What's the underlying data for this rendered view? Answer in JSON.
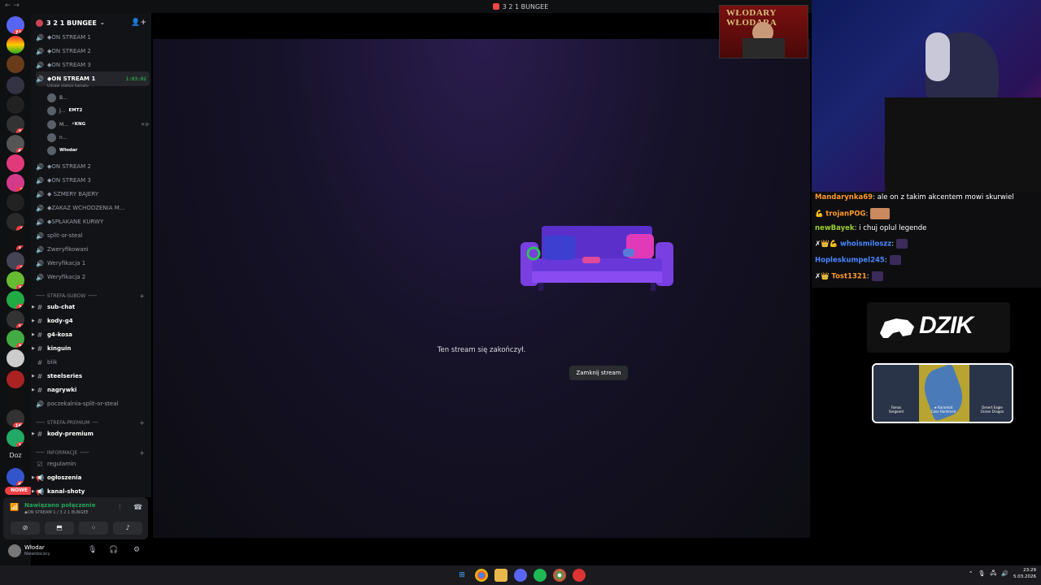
{
  "window": {
    "title": "3 2 1 BUNGEE"
  },
  "server": {
    "name": "3 2 1 BUNGEE"
  },
  "rail_badges": [
    "713",
    "26",
    "61",
    "3",
    "1",
    "16",
    "2",
    "23",
    "20",
    "17",
    "35",
    "162",
    "16",
    "61"
  ],
  "rail_text": {
    "doz": "Doz",
    "nowe": "NOWE"
  },
  "channels": {
    "v1": "◆ON STREAM 1",
    "v2": "◆ON STREAM 2",
    "v3": "◆ON STREAM 3",
    "active": "◆ON STREAM 1",
    "active_timer": "1:03:02",
    "active_status": "Ustaw status kanału",
    "members": [
      {
        "name": "B...",
        "tag": ""
      },
      {
        "name": "J...",
        "tag": "EMT2"
      },
      {
        "name": "M...",
        "tag": "⚡KNG"
      },
      {
        "name": "n...",
        "tag": ""
      },
      {
        "name": "Włodar",
        "tag": ""
      }
    ],
    "v4": "◆ON STREAM 2",
    "v5": "◆ON STREAM 3",
    "v6": "◆ SZMERY BAJERY",
    "v7": "◆ZAKAZ WCHODZENIA M...",
    "v8": "◆SPŁAKANE KURWY",
    "v9": "split-or-steal",
    "t1": "Zweryfikowani",
    "t2": "Weryfikacja 1",
    "t3": "Weryfikacja 2"
  },
  "cat_subow": "STREFA-SUBOW",
  "sub_channels": [
    "sub-chat",
    "kody-g4",
    "g4-kosa",
    "kinguin",
    "blik",
    "steelseries",
    "nagrywki",
    "poczekalnia-split-or-steal"
  ],
  "cat_premium": "STREFA-PREMIUM",
  "premium_channels": [
    "kody-premium"
  ],
  "cat_info": "INFORMACJE",
  "info_channels": [
    "regulamin",
    "ogłoszenia",
    "kanal-shoty"
  ],
  "voice_panel": {
    "status": "Nawiązano połączenie",
    "channel": "◆ON STREAM 1 / 3 2 1 BUNGEE"
  },
  "user": {
    "name": "Włodar",
    "status": "Niewidoczny"
  },
  "stream": {
    "ended": "Ten stream się zakończył.",
    "close": "Zamknij stream"
  },
  "overlay": {
    "wlodary_title": "WŁODARY WŁODARA",
    "chat": [
      {
        "user": "Mandarynka69",
        "msg": " ale on z takim akcentem mowi skurwiel",
        "color": "#ff9a2e"
      },
      {
        "user": "trojanPOG",
        "msg": "",
        "color": "#ff9a2e",
        "prefix": "💪 "
      },
      {
        "user": "newBayek",
        "msg": " i chuj oplul legende",
        "color": "#9acd32"
      },
      {
        "user": "whoismiloszz",
        "msg": "",
        "color": "#4a86ff",
        "prefix": "✗👑💪 "
      },
      {
        "user": "Hopleskumpel245",
        "msg": "",
        "color": "#4a86ff"
      },
      {
        "user": "Tost1321",
        "msg": "",
        "color": "#ff9a2e",
        "prefix": "✗👑 "
      }
    ],
    "sponsor": "DZIK",
    "skins": [
      "Famas",
      "★ Karambit",
      "Desert Eagle"
    ],
    "skin_names": [
      "Sergeant",
      "Case Hardened",
      "Ocean Dragon"
    ]
  },
  "clock": {
    "time": "23:29",
    "date": "5.03.2026"
  },
  "colors": {
    "accent_green": "#23a55a",
    "bg_dark": "#121316"
  }
}
